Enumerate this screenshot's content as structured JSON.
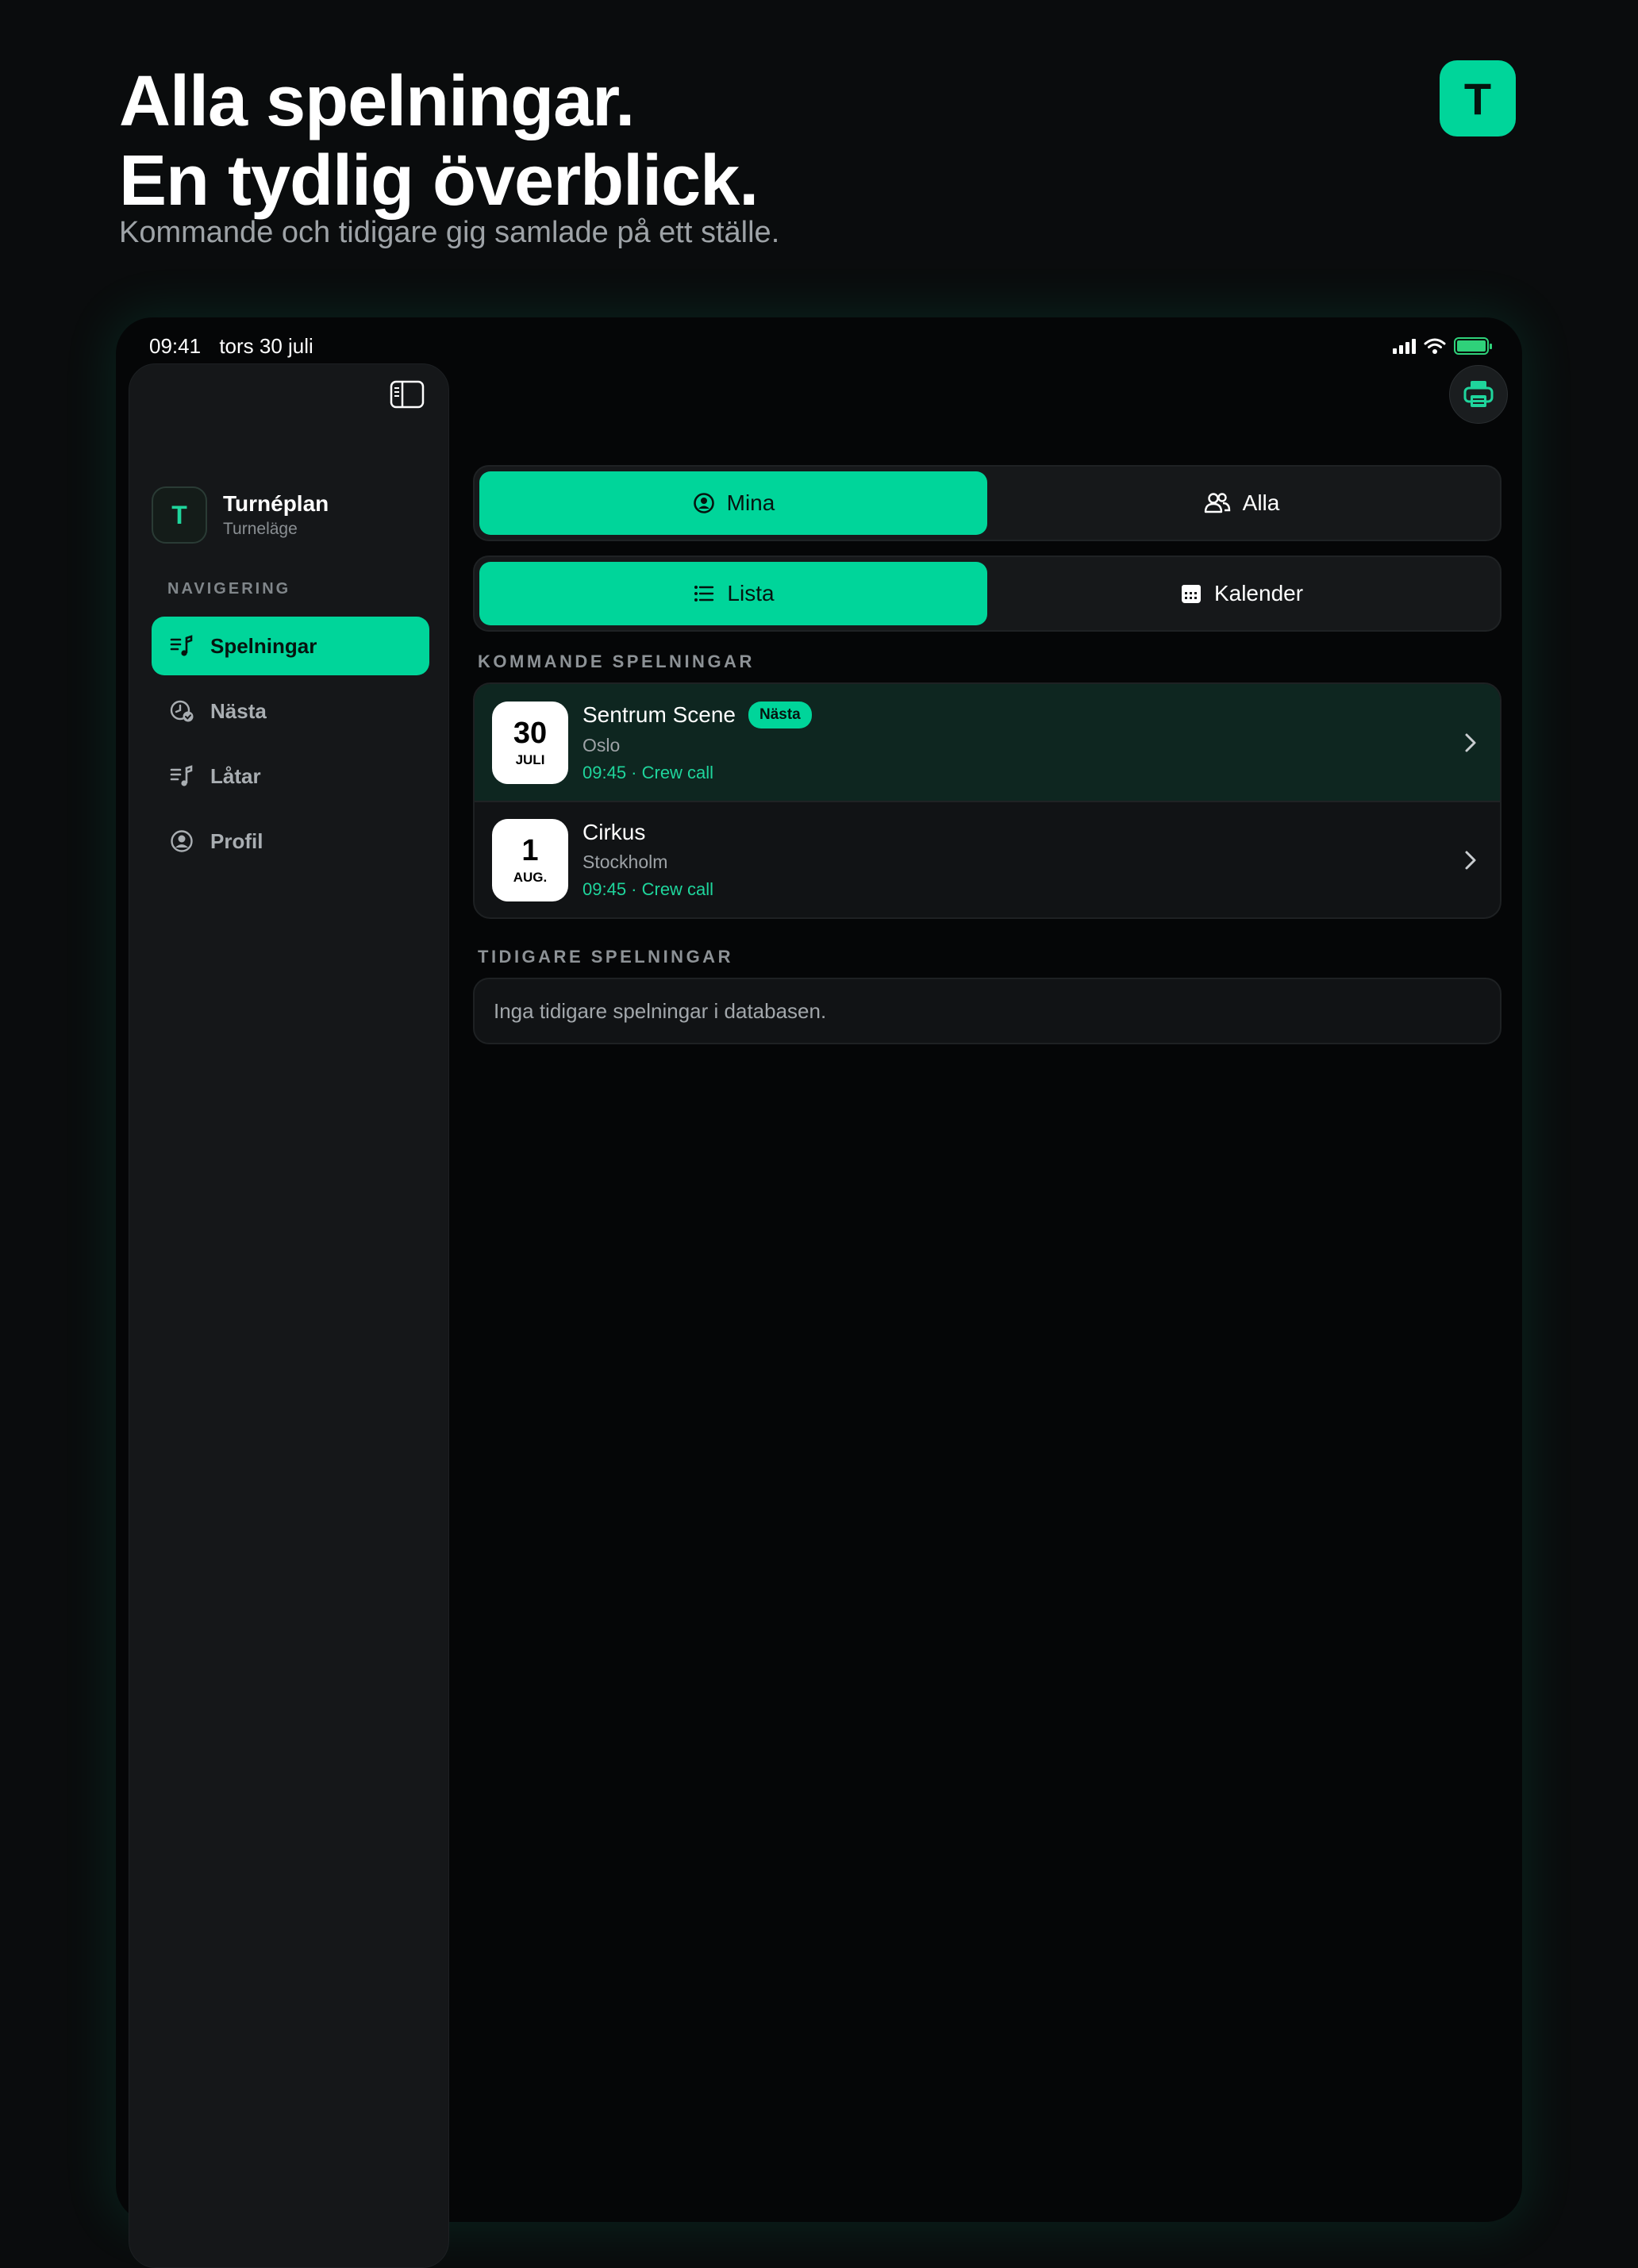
{
  "hero": {
    "line1": "Alla spelningar.",
    "line2": "En tydlig överblick.",
    "subtitle": "Kommande och tidigare gig samlade på ett ställe.",
    "badge_letter": "T"
  },
  "status_bar": {
    "time": "09:41",
    "date": "tors 30 juli"
  },
  "sidebar": {
    "brand_letter": "T",
    "brand_title": "Turnéplan",
    "brand_sub": "Turneläge",
    "nav_heading": "NAVIGERING",
    "items": [
      {
        "label": "Spelningar",
        "icon": "music-list-icon",
        "active": true
      },
      {
        "label": "Nästa",
        "icon": "clock-check-icon",
        "active": false
      },
      {
        "label": "Låtar",
        "icon": "music-list-icon",
        "active": false
      },
      {
        "label": "Profil",
        "icon": "person-circle-icon",
        "active": false
      }
    ]
  },
  "filters": {
    "scope": {
      "mine": "Mina",
      "all": "Alla",
      "selected": "Mina"
    },
    "view": {
      "list": "Lista",
      "calendar": "Kalender",
      "selected": "Lista"
    }
  },
  "upcoming": {
    "heading": "KOMMANDE SPELNINGAR",
    "gigs": [
      {
        "day": "30",
        "month": "JULI",
        "venue": "Sentrum Scene",
        "city": "Oslo",
        "time": "09:45 · Crew call",
        "badge": "Nästa"
      },
      {
        "day": "1",
        "month": "AUG.",
        "venue": "Cirkus",
        "city": "Stockholm",
        "time": "09:45 · Crew call"
      }
    ]
  },
  "past": {
    "heading": "TIDIGARE SPELNINGAR",
    "empty_text": "Inga tidigare spelningar i databasen."
  },
  "colors": {
    "accent": "#00d59a",
    "background": "#0a0c0d",
    "sidebar": "#151719",
    "highlight_row": "#0e2620"
  }
}
